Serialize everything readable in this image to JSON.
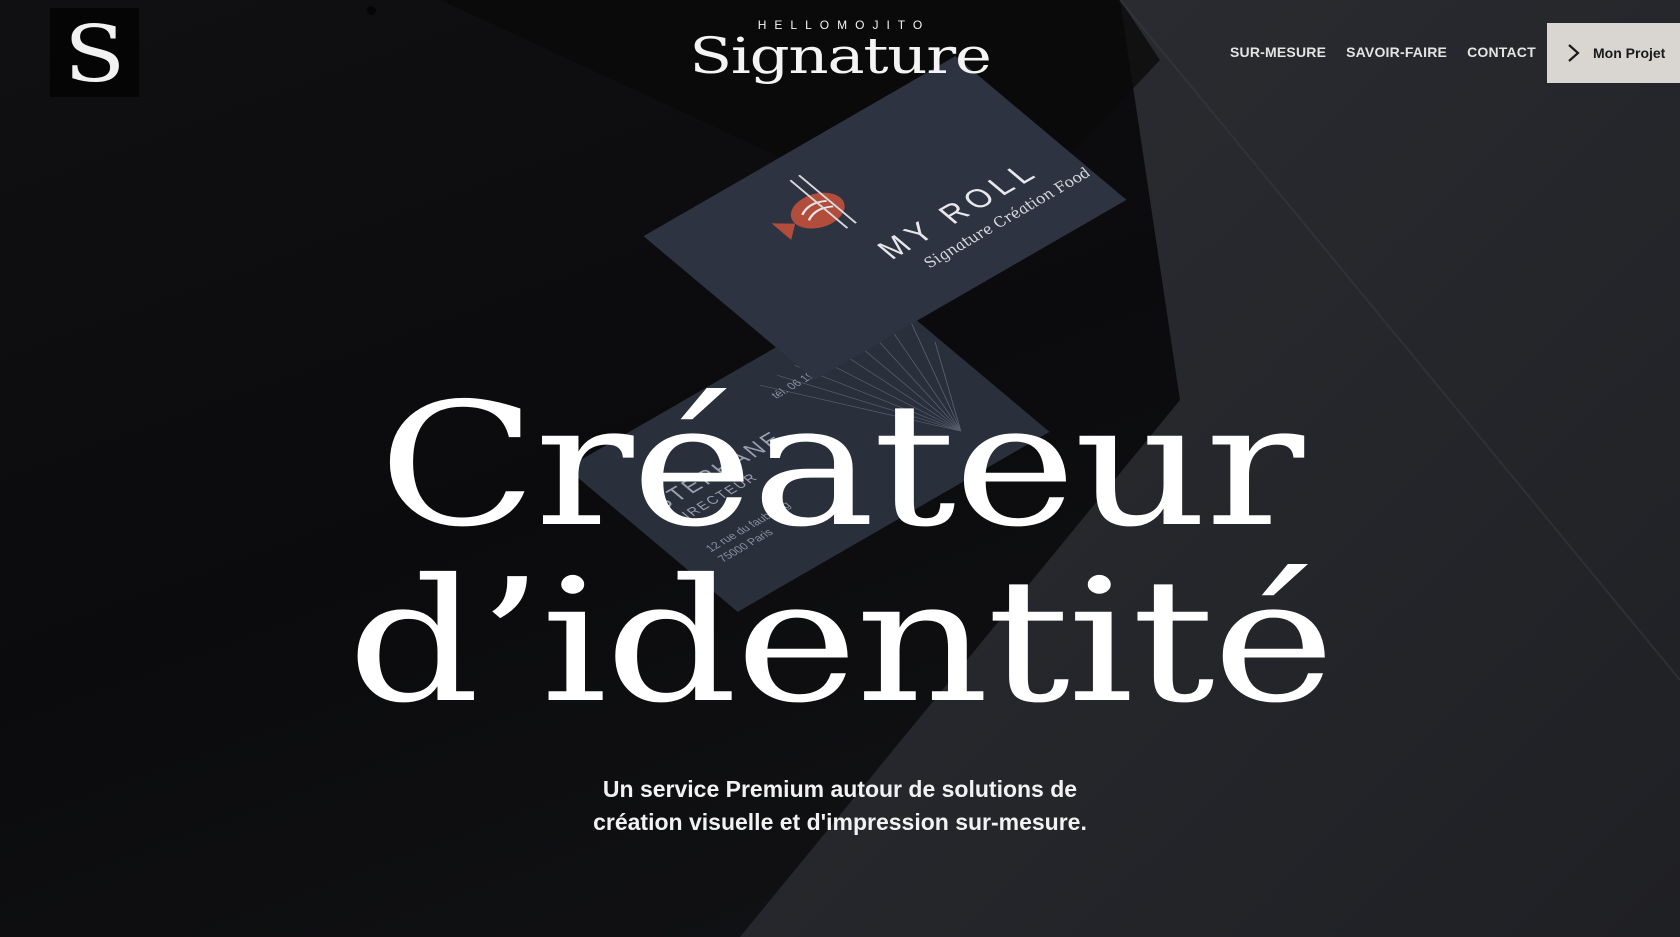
{
  "brand": {
    "logo_letter": "S",
    "supertitle": "HELLOMOJITO",
    "name": "Signature"
  },
  "nav": {
    "items": [
      {
        "label": "SUR-MESURE"
      },
      {
        "label": "SAVOIR-FAIRE"
      },
      {
        "label": "CONTACT"
      }
    ]
  },
  "cta": {
    "label": "Mon Projet",
    "icon": "chevron-right-icon"
  },
  "hero": {
    "headline_line1": "Créateur",
    "headline_line2": "d’identité",
    "subtitle_line1": "Un service Premium autour de solutions de",
    "subtitle_line2": "création visuelle et d'impression sur-mesure."
  },
  "cards": {
    "front_title": "MY ROLL",
    "front_tagline": "Signature Création Food",
    "back_name": "STÉPHANE",
    "back_role": "DIRECTEUR",
    "back_address1": "12 rue du faubourg",
    "back_address2": "75000 Paris",
    "back_phone": "tél. 06 19 29 29 29"
  },
  "colors": {
    "background": "#0d0d0f",
    "text": "#ffffff",
    "cta_bg": "#d9d6d1",
    "card": "#2c3140",
    "fish_accent": "#c1503b"
  }
}
